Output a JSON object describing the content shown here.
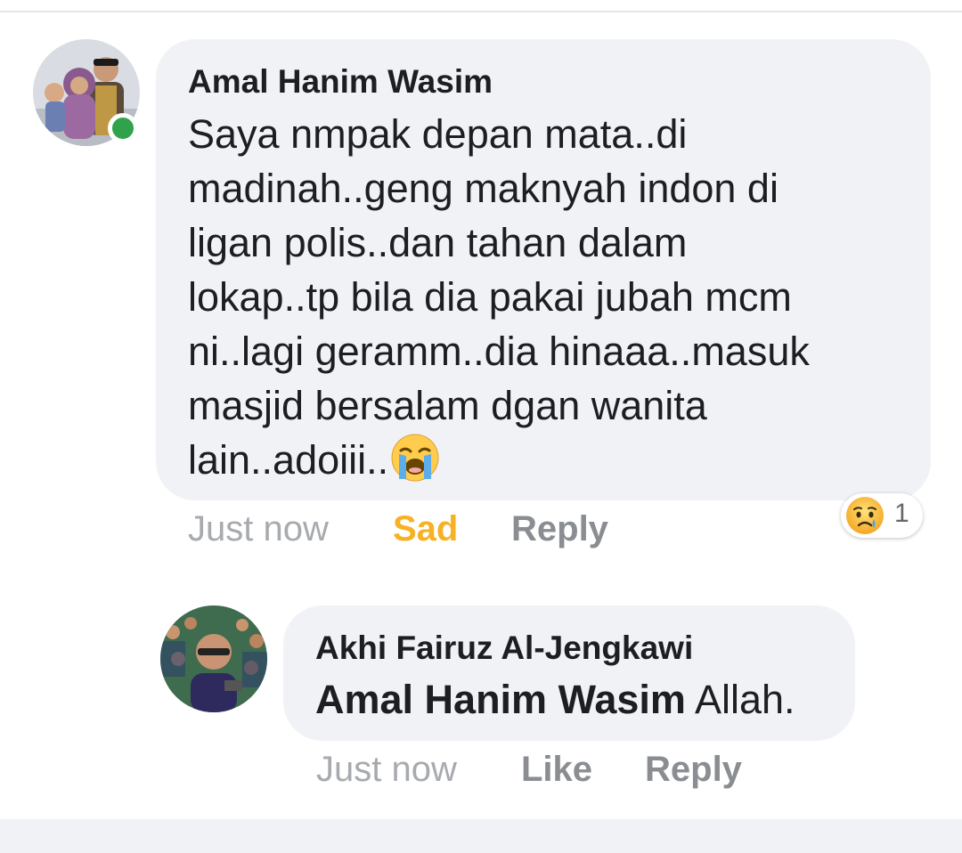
{
  "comment": {
    "author": "Amal Hanim Wasim",
    "text_lines": [
      "Saya nmpak depan mata..di",
      "madinah..geng maknyah indon di",
      "ligan polis..dan tahan dalam",
      "lokap..tp bila dia pakai jubah mcm",
      "ni..lagi geramm..dia hinaaa..masuk",
      "masjid bersalam dgan wanita",
      "lain..adoiii.."
    ],
    "trailing_emoji": "loudly-crying-face",
    "time": "Just now",
    "reaction_label": "Sad",
    "reply_label": "Reply",
    "reaction_summary": {
      "emoji": "sad-face",
      "count": "1"
    },
    "online": true
  },
  "reply": {
    "author": "Akhi Fairuz Al-Jengkawi",
    "mention": "Amal Hanim Wasim",
    "text": " Allah.",
    "time": "Just now",
    "like_label": "Like",
    "reply_label": "Reply"
  },
  "colors": {
    "bubble": "#f0f2f5",
    "text": "#1c1e21",
    "sad_reaction": "#f7b125",
    "online": "#31a24c",
    "muted": "#8a8d91"
  }
}
